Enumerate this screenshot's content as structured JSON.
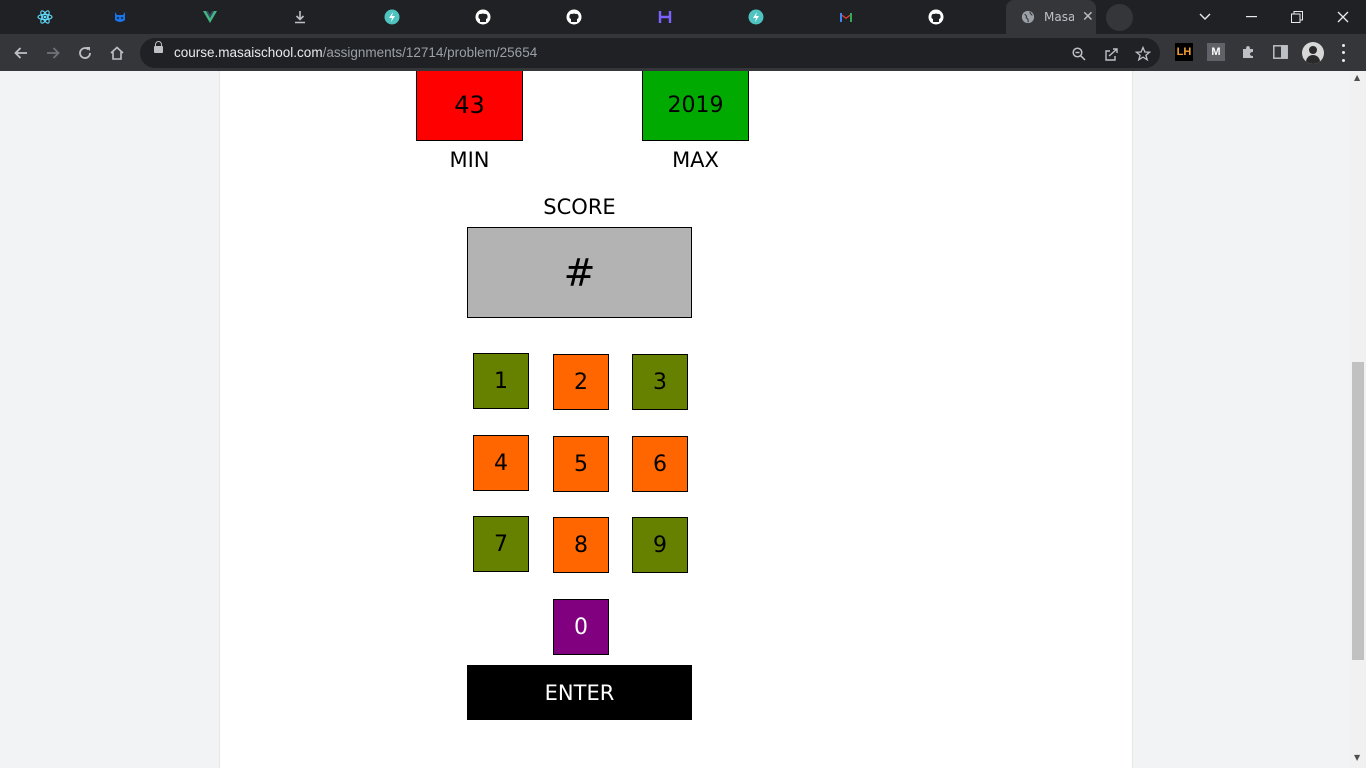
{
  "browser": {
    "tabs": [
      {
        "icon": "react-icon",
        "color": "#61dafb"
      },
      {
        "icon": "cat-icon",
        "color": "#1a73e8"
      },
      {
        "icon": "vue-icon",
        "color": "#41b883"
      },
      {
        "icon": "download-icon",
        "color": "#bdc1c6"
      },
      {
        "icon": "bolt-icon",
        "color": "#4fc3c0"
      },
      {
        "icon": "github-icon",
        "color": "#ffffff"
      },
      {
        "icon": "github-icon",
        "color": "#ffffff"
      },
      {
        "icon": "h-icon",
        "color": "#7b61ff"
      },
      {
        "icon": "bolt-icon",
        "color": "#4fc3c0"
      },
      {
        "icon": "gmail-icon",
        "color": "#ea4335"
      },
      {
        "icon": "github-icon",
        "color": "#ffffff"
      }
    ],
    "active_tab": {
      "title": "Masai School",
      "icon": "globe-icon"
    },
    "url_host": "course.masaischool.com",
    "url_path": "/assignments/12714/problem/25654"
  },
  "game": {
    "min_value": "43",
    "min_label": "MIN",
    "max_value": "2019",
    "max_label": "MAX",
    "score_label": "SCORE",
    "score_value": "#",
    "keys": [
      "1",
      "2",
      "3",
      "4",
      "5",
      "6",
      "7",
      "8",
      "9",
      "0"
    ],
    "enter_label": "ENTER",
    "colors": {
      "min": "#ff0000",
      "max": "#00aa00",
      "score": "#b3b3b3",
      "olive": "#668000",
      "orange": "#ff6600",
      "purple": "#800080",
      "enter": "#000000"
    }
  }
}
